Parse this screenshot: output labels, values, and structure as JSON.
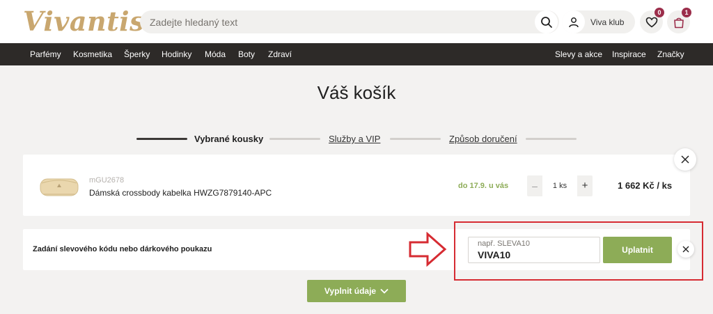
{
  "header": {
    "logo": "Vivantis",
    "search_placeholder": "Zadejte hledaný text",
    "viva_klub": "Viva klub",
    "wishlist_count": "0",
    "cart_count": "1"
  },
  "nav": {
    "left": [
      "Parfémy",
      "Kosmetika",
      "Šperky",
      "Hodinky",
      "Móda",
      "Boty",
      "Zdraví"
    ],
    "right": [
      "Slevy a akce",
      "Inspirace",
      "Značky"
    ]
  },
  "page_title": "Váš košík",
  "steps": [
    "Vybrané kousky",
    "Služby a VIP",
    "Způsob doručení"
  ],
  "cart_item": {
    "code": "mGU2678",
    "name": "Dámská crossbody kabelka HWZG7879140-APC",
    "delivery": "do 17.9. u vás",
    "qty_minus": "–",
    "quantity": "1 ks",
    "qty_plus": "+",
    "price": "1 662 Kč / ks"
  },
  "coupon": {
    "label": "Zadání slevového kódu nebo dárkového poukazu",
    "placeholder": "např. SLEVA10",
    "value": "VIVA10",
    "apply": "Uplatnit"
  },
  "continue_button": "Vyplnit údaje",
  "colors": {
    "accent_green": "#8dac57",
    "brand_gold": "#c9a76f",
    "nav_bg": "#2d2a28",
    "badge": "#9b2d4a",
    "highlight_red": "#d62b32"
  }
}
